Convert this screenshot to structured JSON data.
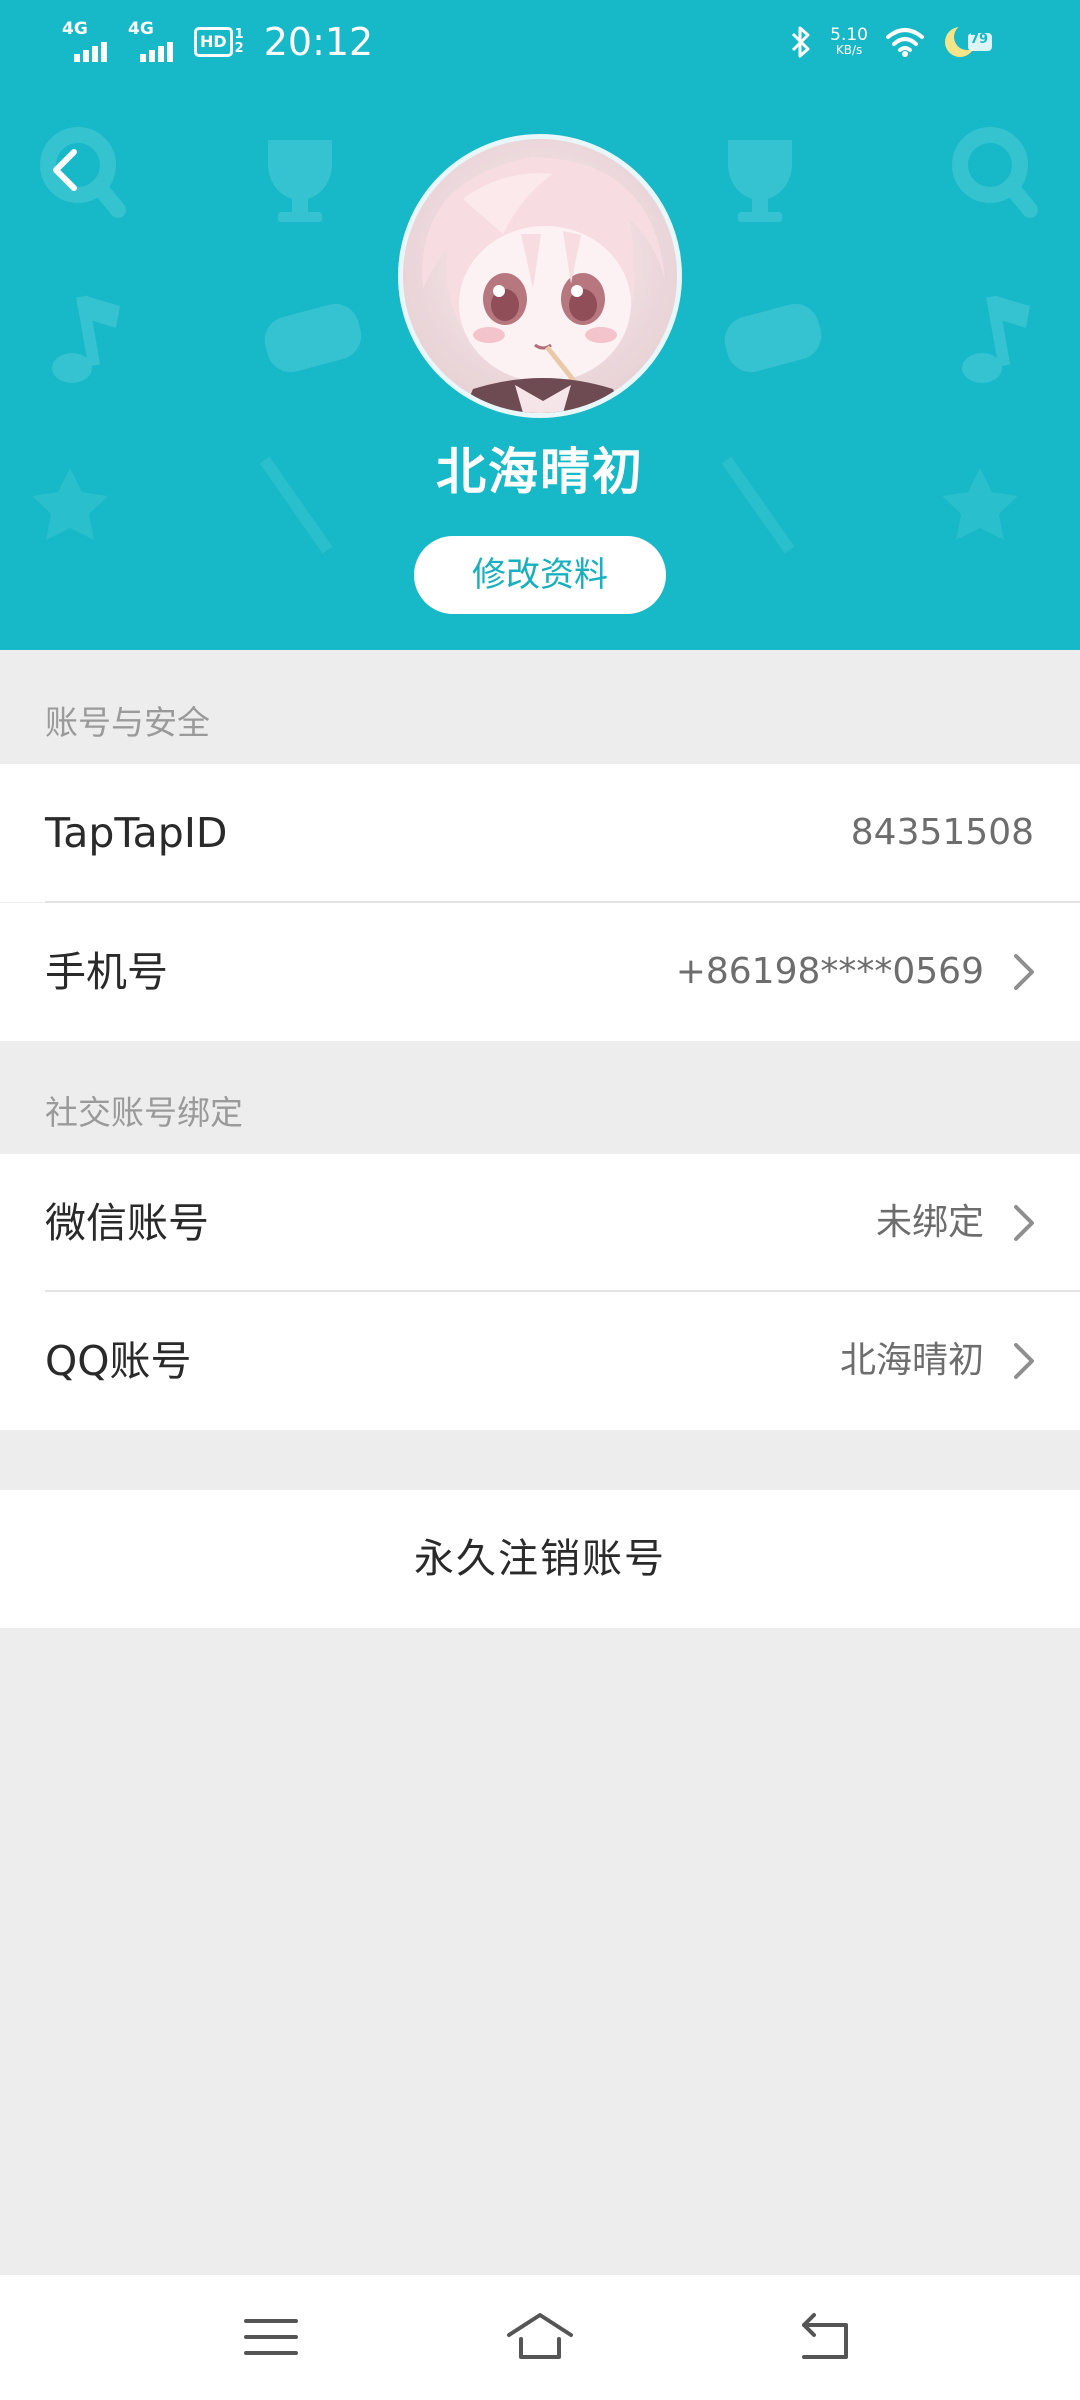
{
  "status_bar": {
    "network_1": "4G",
    "network_2": "4G",
    "hd_label": "HD",
    "hd_sub_top": "1",
    "hd_sub_bottom": "2",
    "time": "20:12",
    "speed_value": "5.10",
    "speed_unit": "KB/s",
    "battery_level": "79"
  },
  "header": {
    "username": "北海晴初",
    "edit_button_label": "修改资料",
    "background_color": "#17b8c7"
  },
  "account_security": {
    "section_title": "账号与安全",
    "rows": [
      {
        "label": "TapTapID",
        "value": "84351508"
      },
      {
        "label": "手机号",
        "value": "+86198****0569"
      }
    ]
  },
  "social_binding": {
    "section_title": "社交账号绑定",
    "rows": [
      {
        "label": "微信账号",
        "value": "未绑定"
      },
      {
        "label": "QQ账号",
        "value": "北海晴初"
      }
    ]
  },
  "delete_account_label": "永久注销账号",
  "icons": {
    "back": "back-arrow-icon",
    "chevron": "chevron-right-icon",
    "nav_menu": "menu-icon",
    "nav_home": "home-icon",
    "nav_back": "back-return-icon"
  }
}
